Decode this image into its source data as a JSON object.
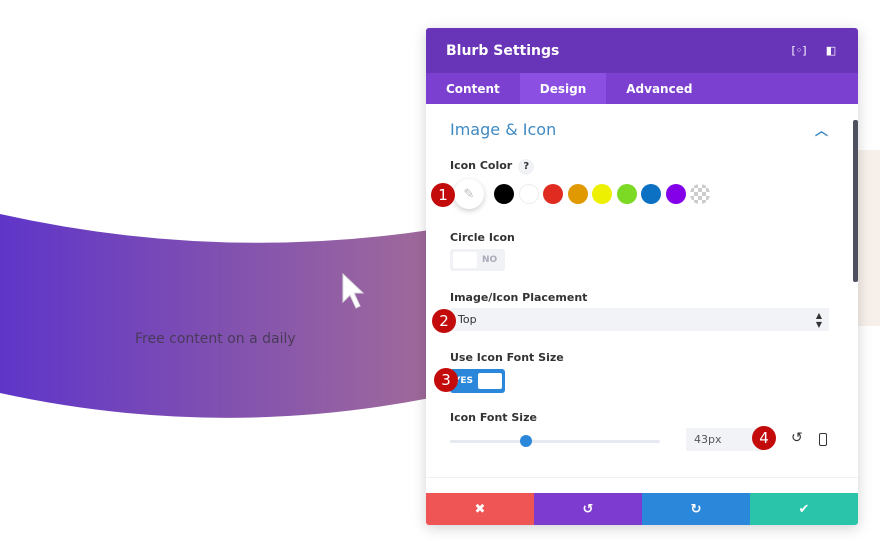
{
  "background": {
    "text": "Free content on a daily",
    "band_color_start": "#5f35c9",
    "band_color_end": "#a06a9a"
  },
  "panel": {
    "title": "Blurb Settings",
    "header_icons": [
      "fullscreen-icon",
      "sidebar-layout-icon"
    ],
    "tabs": [
      {
        "label": "Content",
        "active": false
      },
      {
        "label": "Design",
        "active": true
      },
      {
        "label": "Advanced",
        "active": false
      }
    ],
    "section": {
      "title": "Image & Icon",
      "expanded": true
    },
    "icon_color": {
      "label": "Icon Color",
      "help": "?",
      "swatches": [
        "#000000",
        "#ffffff",
        "#e02b20",
        "#e09900",
        "#edf000",
        "#7cda24",
        "#0c71c3",
        "#8300e9",
        "transparent"
      ]
    },
    "circle_icon": {
      "label": "Circle Icon",
      "value": "NO"
    },
    "placement": {
      "label": "Image/Icon Placement",
      "value": "Top"
    },
    "use_icon_font_size": {
      "label": "Use Icon Font Size",
      "value": "YES"
    },
    "icon_font_size": {
      "label": "Icon Font Size",
      "value": "43px",
      "slider_fraction": 0.36
    },
    "footer": {
      "cancel": "✖",
      "undo": "↺",
      "redo": "↻",
      "save": "✔",
      "colors": [
        "#ef5555",
        "#7e3bd0",
        "#2b87da",
        "#29c4a9"
      ]
    }
  },
  "annotations": [
    "1",
    "2",
    "3",
    "4"
  ]
}
